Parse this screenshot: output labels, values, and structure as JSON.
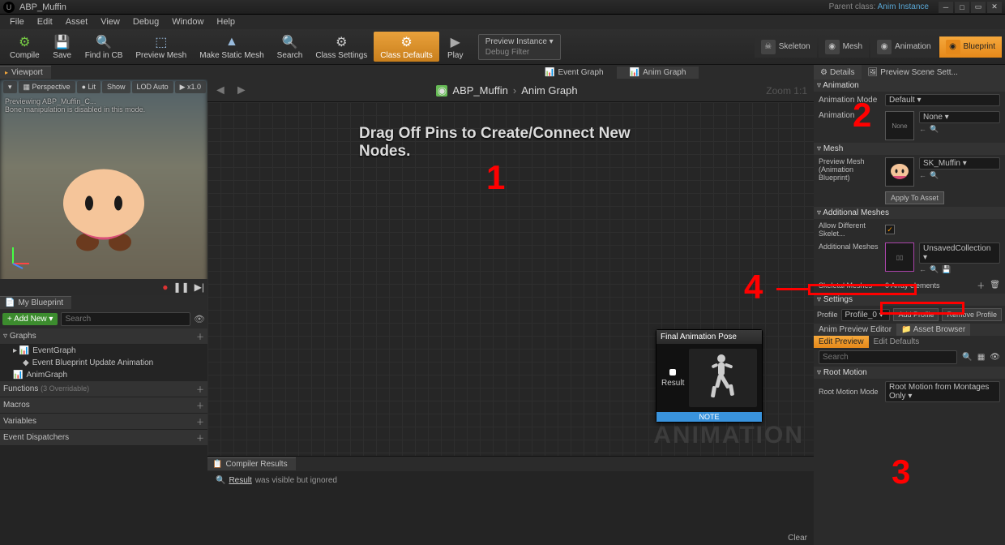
{
  "titlebar": {
    "title": "ABP_Muffin",
    "parent_label": "Parent class:",
    "parent_class": "Anim Instance"
  },
  "menu": [
    "File",
    "Edit",
    "Asset",
    "View",
    "Debug",
    "Window",
    "Help"
  ],
  "toolbar": {
    "compile": "Compile",
    "save": "Save",
    "findincb": "Find in CB",
    "preview_mesh": "Preview Mesh",
    "make_static": "Make Static Mesh",
    "search": "Search",
    "class_settings": "Class Settings",
    "class_defaults": "Class Defaults",
    "play": "Play",
    "preview_instance": "Preview Instance ▾",
    "debug_filter": "Debug Filter"
  },
  "modes": {
    "skeleton": "Skeleton",
    "mesh": "Mesh",
    "animation": "Animation",
    "blueprint": "Blueprint"
  },
  "viewport": {
    "tab": "Viewport",
    "perspective": "Perspective",
    "lit": "Lit",
    "show": "Show",
    "lod": "LOD Auto",
    "speed": "x1.0",
    "preview_text": "Previewing ABP_Muffin_C...",
    "bone_text": "Bone manipulation is disabled in this mode."
  },
  "mybp": {
    "tab": "My Blueprint",
    "add_new": "+ Add New ▾",
    "search_ph": "Search",
    "sections": {
      "graphs": "Graphs",
      "functions": "Functions",
      "functions_hint": "(3 Overridable)",
      "macros": "Macros",
      "variables": "Variables",
      "dispatchers": "Event Dispatchers"
    },
    "event_graph": "EventGraph",
    "update_anim": "Event Blueprint Update Animation",
    "anim_graph": "AnimGraph"
  },
  "graph": {
    "tab_event": "Event Graph",
    "tab_anim": "Anim Graph",
    "bc_asset": "ABP_Muffin",
    "bc_graph": "Anim Graph",
    "zoom": "Zoom 1:1",
    "hint": "Drag Off Pins to Create/Connect New Nodes.",
    "watermark": "ANIMATION",
    "node_title": "Final Animation Pose",
    "node_pin": "Result",
    "node_note": "NOTE"
  },
  "compiler": {
    "tab": "Compiler Results",
    "result_label": "Result",
    "msg": "was visible but ignored",
    "clear": "Clear"
  },
  "details": {
    "tab_details": "Details",
    "tab_scene": "Preview Scene Sett...",
    "sec_animation": "Animation",
    "anim_mode": "Animation Mode",
    "anim_mode_val": "Default",
    "animation_lbl": "Animation",
    "anim_val": "None",
    "sec_mesh": "Mesh",
    "preview_mesh_lbl": "Preview Mesh (Animation Blueprint)",
    "mesh_val": "SK_Muffin",
    "apply_asset": "Apply To Asset",
    "sec_addmesh": "Additional Meshes",
    "allow_diff": "Allow Different Skelet...",
    "add_meshes_lbl": "Additional Meshes",
    "unsaved": "UnsavedCollection",
    "skel_meshes": "Skeletal Meshes",
    "skel_count": "0 Array elements",
    "sec_settings": "Settings",
    "profile_lbl": "Profile",
    "profile_val": "Profile_0",
    "add_profile": "Add Profile",
    "remove_profile": "Remove Profile",
    "subtab_preview": "Anim Preview Editor",
    "subtab_browser": "Asset Browser",
    "edit_preview": "Edit Preview",
    "edit_defaults": "Edit Defaults",
    "sec_rootmotion": "Root Motion",
    "root_mode_lbl": "Root Motion Mode",
    "root_mode_val": "Root Motion from Montages Only ▾"
  },
  "annotations": {
    "n1": "1",
    "n2": "2",
    "n3": "3",
    "n4": "4"
  }
}
